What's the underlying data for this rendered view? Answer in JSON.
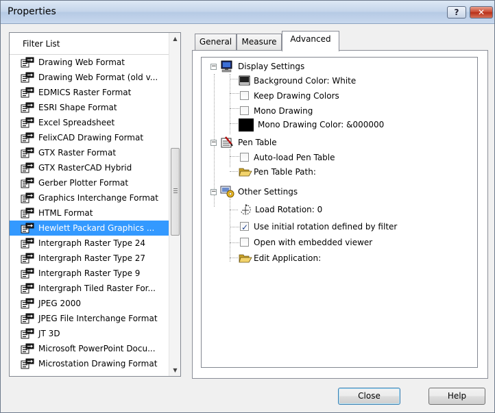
{
  "window": {
    "title": "Properties"
  },
  "filter_list": {
    "header": "Filter List",
    "selected_index": 11,
    "items": [
      "Drawing Web Format",
      "Drawing Web Format (old v...",
      "EDMICS Raster Format",
      "ESRI Shape Format",
      "Excel Spreadsheet",
      "FelixCAD Drawing Format",
      "GTX Raster Format",
      "GTX RasterCAD Hybrid",
      "Gerber Plotter Format",
      "Graphics Interchange Format",
      "HTML Format",
      "Hewlett Packard Graphics ...",
      "Intergraph Raster Type 24",
      "Intergraph Raster Type 27",
      "Intergraph Raster Type 9",
      "Intergraph Tiled Raster For...",
      "JPEG 2000",
      "JPEG File Interchange Format",
      "JT 3D",
      "Microsoft PowerPoint Docu...",
      "Microstation Drawing Format"
    ]
  },
  "tabs": [
    "General",
    "Measure",
    "Advanced"
  ],
  "active_tab": "Advanced",
  "tree": {
    "display_settings": {
      "label": "Display Settings",
      "background_color": "Background Color: White",
      "keep_drawing_colors": "Keep Drawing Colors",
      "mono_drawing": "Mono Drawing",
      "mono_drawing_color": "Mono Drawing Color: &000000"
    },
    "pen_table": {
      "label": "Pen Table",
      "auto_load": "Auto-load Pen Table",
      "path": "Pen Table Path:"
    },
    "other_settings": {
      "label": "Other Settings",
      "load_rotation": "Load Rotation: 0",
      "use_initial_rotation": "Use initial rotation defined by filter",
      "use_initial_rotation_checked": true,
      "open_embedded": "Open with embedded viewer",
      "edit_application": "Edit Application:"
    }
  },
  "buttons": {
    "close": "Close",
    "help": "Help"
  },
  "colors": {
    "selection": "#3399ff",
    "mono_swatch": "#000000"
  }
}
